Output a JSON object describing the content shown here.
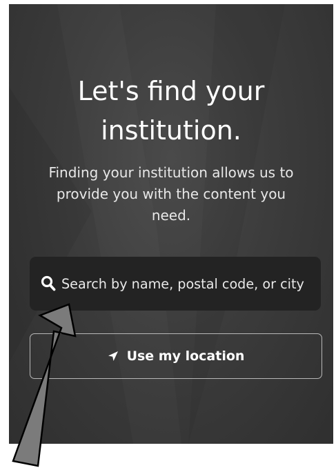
{
  "heading": {
    "line1": "Let's find your",
    "line2": "institution."
  },
  "description": "Finding your institution allows us to provide you with the content you need.",
  "search": {
    "placeholder": "Search by name, postal code, or city",
    "icon": "search-icon"
  },
  "location_button": {
    "label": "Use my location",
    "icon": "location-arrow-icon"
  },
  "colors": {
    "background": "#3c3c3c",
    "search_bg": "#232323",
    "text": "#ffffff",
    "button_border": "#b9b9b9"
  }
}
